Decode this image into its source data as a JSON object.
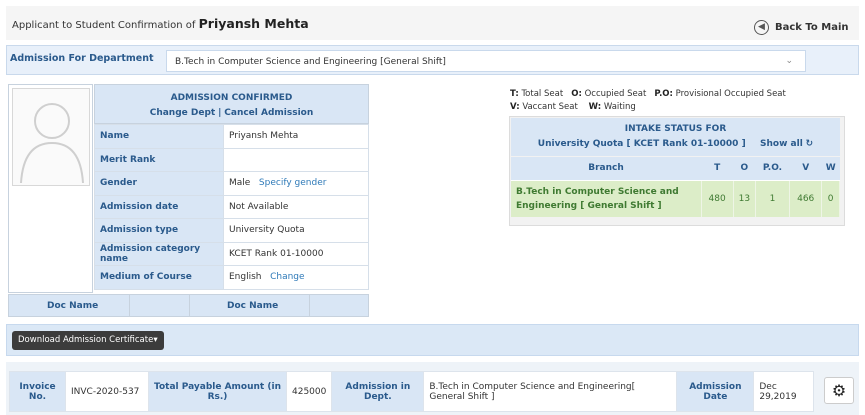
{
  "header": {
    "title_prefix": "Applicant to Student Confirmation of",
    "student_name": "Priyansh Mehta",
    "back_label": "Back To Main"
  },
  "department": {
    "label": "Admission For Department",
    "selected": "B.Tech in Computer Science and Engineering [General Shift]"
  },
  "admission": {
    "status": "ADMISSION CONFIRMED",
    "change_dept": "Change Dept",
    "separator": "|",
    "cancel": "Cancel Admission"
  },
  "info_rows": [
    {
      "label": "Name",
      "value": "Priyansh Mehta"
    },
    {
      "label": "Merit Rank",
      "value": ""
    },
    {
      "label": "Gender",
      "value": "Male",
      "link": "Specify gender"
    },
    {
      "label": "Admission date",
      "value": "Not Available"
    },
    {
      "label": "Admission type",
      "value": "University Quota"
    },
    {
      "label": "Admission category name",
      "value": "KCET Rank 01-10000"
    },
    {
      "label": "Medium of Course",
      "value": "English",
      "link": "Change"
    }
  ],
  "docs": {
    "col1": "Doc Name",
    "col2": "Doc Name"
  },
  "legend": {
    "t_key": "T:",
    "t": "Total Seat",
    "o_key": "O:",
    "o": "Occupied Seat",
    "po_key": "P.O:",
    "po": "Provisional Occupied Seat",
    "v_key": "V:",
    "v": "Vaccant Seat",
    "w_key": "W:",
    "w": "Waiting"
  },
  "intake": {
    "title": "INTAKE STATUS FOR",
    "quota": "University Quota [ KCET Rank 01-10000 ]",
    "show_all": "Show all",
    "columns": [
      "Branch",
      "T",
      "O",
      "P.O.",
      "V",
      "W"
    ],
    "row": {
      "branch": "B.Tech in Computer Science and Engineering [ General Shift ]",
      "t": "480",
      "o": "13",
      "po": "1",
      "v": "466",
      "w": "0"
    }
  },
  "certificate": {
    "button": "Download Admission Certificate"
  },
  "invoice": {
    "invoice_label": "Invoice No.",
    "invoice_value": "INVC-2020-537",
    "amount_label": "Total Payable Amount (in Rs.)",
    "amount_value": "425000",
    "dept_label": "Admission in Dept.",
    "dept_value": "B.Tech in Computer Science and Engineering[ General Shift ]",
    "date_label": "Admission Date",
    "date_value": "Dec 29,2019"
  }
}
